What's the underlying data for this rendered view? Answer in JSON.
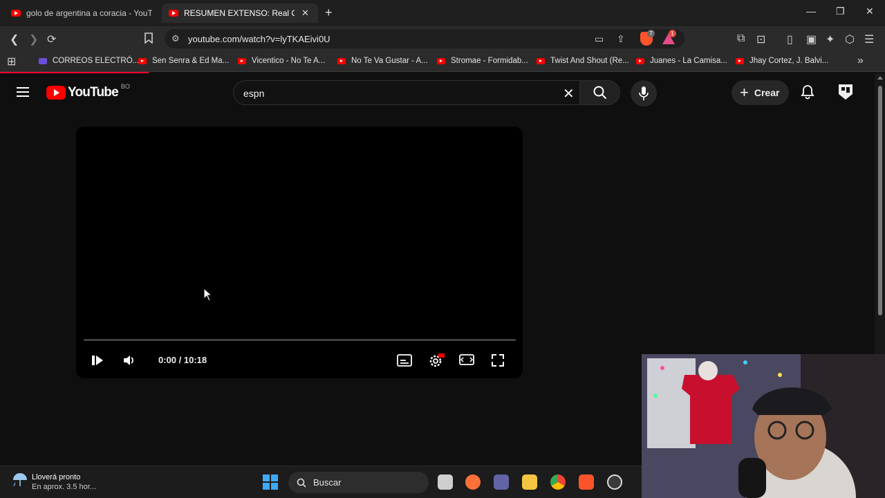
{
  "browser": {
    "tabs": [
      {
        "title": "golo de argentina a coracia - YouTube",
        "active": false
      },
      {
        "title": "RESUMEN EXTENSO: Real Oruro",
        "active": true
      }
    ],
    "url": "youtube.com/watch?v=lyTKAEivi0U",
    "brave_badge": "7",
    "alert_badge": "1",
    "bookmarks": [
      {
        "label": "CORREOS ELECTRÓ...",
        "icon": "purple"
      },
      {
        "label": "Sen Senra & Ed Ma...",
        "icon": "youtube"
      },
      {
        "label": "Vicentico - No Te A...",
        "icon": "youtube"
      },
      {
        "label": "No Te Va Gustar - A...",
        "icon": "youtube"
      },
      {
        "label": "Stromae - Formidab...",
        "icon": "youtube"
      },
      {
        "label": "Twist And Shout (Re...",
        "icon": "youtube"
      },
      {
        "label": "Juanes - La Camisa...",
        "icon": "youtube"
      },
      {
        "label": "Jhay Cortez, J. Balvi...",
        "icon": "youtube"
      }
    ]
  },
  "youtube": {
    "logo_text": "YouTube",
    "country_code": "BO",
    "search_query": "espn",
    "create_label": "Crear"
  },
  "player": {
    "time": "0:00 / 10:18",
    "progress": 0,
    "state": "paused"
  },
  "taskbar": {
    "weather_title": "Lloverá pronto",
    "weather_sub": "En aprox. 3.5 hor...",
    "search_placeholder": "Buscar"
  },
  "colors": {
    "youtube_red": "#ff0000",
    "page_bg": "#0f0f0f",
    "chrome_bg": "#2b2b2b"
  }
}
